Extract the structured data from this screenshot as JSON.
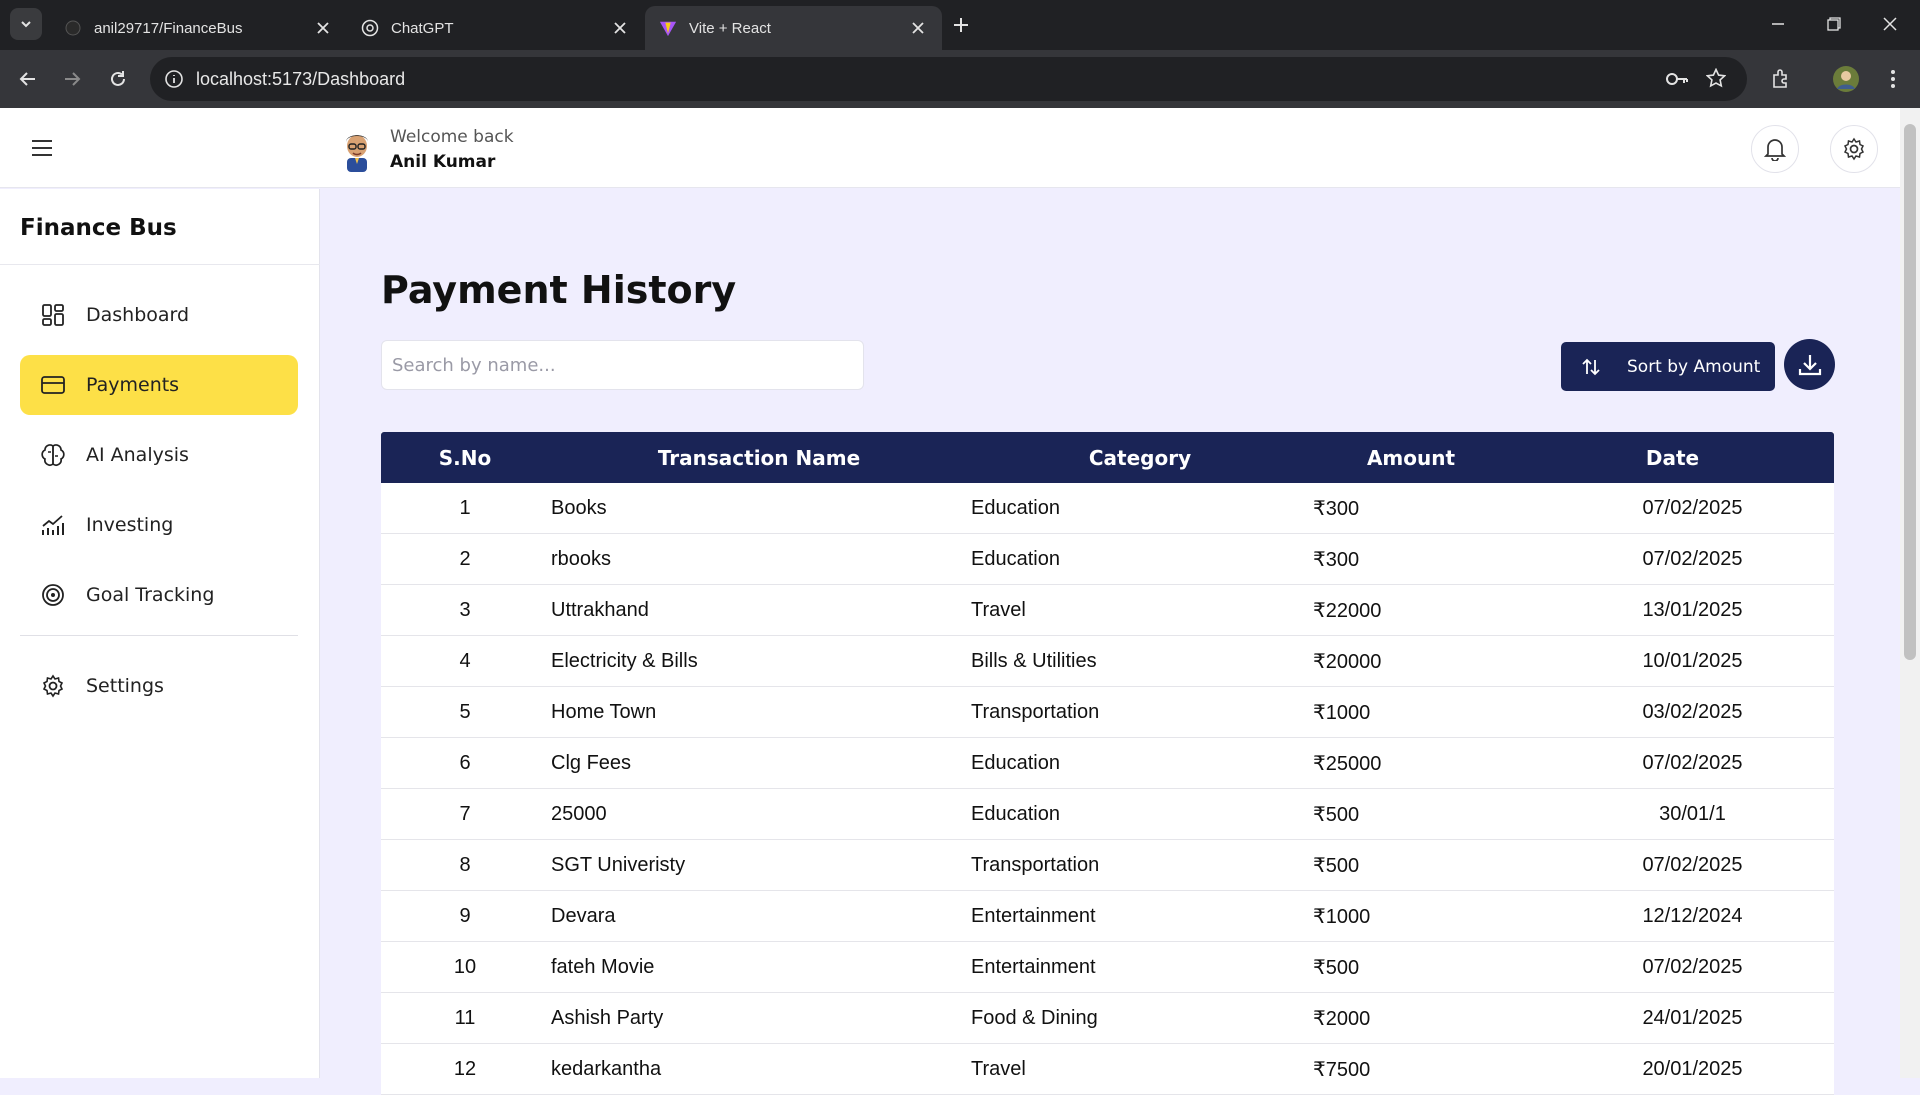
{
  "browser": {
    "tabs": [
      {
        "title": "anil29717/FinanceBus",
        "icon": "github-icon"
      },
      {
        "title": "ChatGPT",
        "icon": "chatgpt-icon"
      },
      {
        "title": "Vite + React",
        "icon": "vite-icon",
        "active": true
      }
    ],
    "url": "localhost:5173/Dashboard"
  },
  "header": {
    "welcome": "Welcome back",
    "user_name": "Anil Kumar"
  },
  "sidebar": {
    "brand": "Finance Bus",
    "items": [
      {
        "label": "Dashboard",
        "icon": "dashboard-icon"
      },
      {
        "label": "Payments",
        "icon": "card-icon",
        "active": true
      },
      {
        "label": "AI Analysis",
        "icon": "brain-icon"
      },
      {
        "label": "Investing",
        "icon": "chart-icon"
      },
      {
        "label": "Goal Tracking",
        "icon": "target-icon"
      },
      {
        "label": "Settings",
        "icon": "gear-icon"
      }
    ]
  },
  "main": {
    "title": "Payment History",
    "search_placeholder": "Search by name...",
    "sort_label": "Sort by Amount",
    "columns": [
      "S.No",
      "Transaction Name",
      "Category",
      "Amount",
      "Date"
    ],
    "rows": [
      [
        "1",
        "Books",
        "Education",
        "₹300",
        "07/02/2025"
      ],
      [
        "2",
        "rbooks",
        "Education",
        "₹300",
        "07/02/2025"
      ],
      [
        "3",
        "Uttrakhand",
        "Travel",
        "₹22000",
        "13/01/2025"
      ],
      [
        "4",
        "Electricity & Bills",
        "Bills & Utilities",
        "₹20000",
        "10/01/2025"
      ],
      [
        "5",
        "Home Town",
        "Transportation",
        "₹1000",
        "03/02/2025"
      ],
      [
        "6",
        "Clg Fees",
        "Education",
        "₹25000",
        "07/02/2025"
      ],
      [
        "7",
        "25000",
        "Education",
        "₹500",
        "30/01/1"
      ],
      [
        "8",
        "SGT Univeristy",
        "Transportation",
        "₹500",
        "07/02/2025"
      ],
      [
        "9",
        "Devara",
        "Entertainment",
        "₹1000",
        "12/12/2024"
      ],
      [
        "10",
        "fateh Movie",
        "Entertainment",
        "₹500",
        "07/02/2025"
      ],
      [
        "11",
        "Ashish Party",
        "Food & Dining",
        "₹2000",
        "24/01/2025"
      ],
      [
        "12",
        "kedarkantha",
        "Travel",
        "₹7500",
        "20/01/2025"
      ]
    ]
  },
  "colors": {
    "accent_navy": "#1a2456",
    "active_yellow": "#fde047",
    "page_bg": "#f0eefe"
  }
}
